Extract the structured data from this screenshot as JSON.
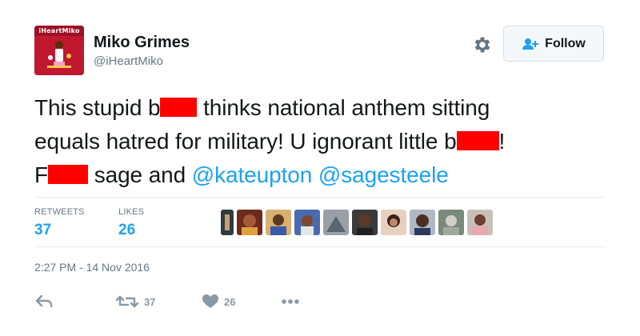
{
  "user": {
    "avatar_text": "iHeartMiko",
    "name": "Miko Grimes",
    "handle": "@iHeartMiko"
  },
  "follow_button": {
    "label": "Follow",
    "icon": "add-user-icon"
  },
  "settings": {
    "icon": "gear-icon"
  },
  "tweet": {
    "line1_a": "This stupid b",
    "line1_b": " thinks national anthem sitting",
    "line2_a": "equals hatred for military! U ignorant little b",
    "line2_b": "!",
    "line3_a": "F",
    "line3_b": " sage and ",
    "mention1": "@kateupton",
    "mention2": "@sagesteele",
    "redaction_color": "#ff0000"
  },
  "stats": {
    "retweets_label": "RETWEETS",
    "retweets_count": "37",
    "likes_label": "LIKES",
    "likes_count": "26"
  },
  "timestamp": "2:27 PM - 14 Nov 2016",
  "actions": {
    "reply_icon": "reply-icon",
    "retweet_icon": "retweet-icon",
    "retweet_count": "37",
    "like_icon": "heart-icon",
    "like_count": "26",
    "more_icon": "more-dots-icon"
  },
  "colors": {
    "accent": "#1da1f2",
    "text": "#14171a",
    "secondary": "#657786",
    "icon_gray": "#8899a6",
    "avatar_bg": "#c0182f"
  }
}
